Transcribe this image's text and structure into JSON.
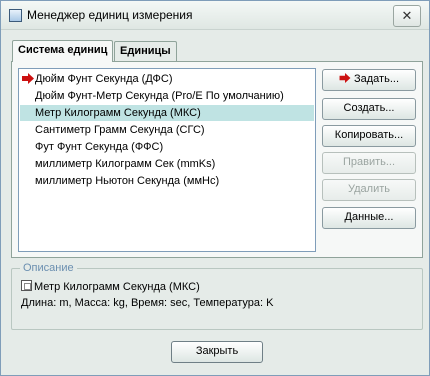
{
  "window": {
    "title": "Менеджер единиц измерения",
    "close_glyph": "✕"
  },
  "tabs": [
    {
      "label": "Система единиц",
      "active": true
    },
    {
      "label": "Единицы",
      "active": false
    }
  ],
  "list": {
    "items": [
      {
        "label": "Дюйм Фунт Секунда (ДФС)",
        "current": true,
        "selected": false
      },
      {
        "label": "Дюйм Фунт-Метр Секунда (Pro/E По умолчанию)",
        "current": false,
        "selected": false
      },
      {
        "label": "Метр Килограмм Секунда (МКС)",
        "current": false,
        "selected": true
      },
      {
        "label": "Сантиметр Грамм Секунда (СГС)",
        "current": false,
        "selected": false
      },
      {
        "label": "Фут Фунт Секунда (ФФС)",
        "current": false,
        "selected": false
      },
      {
        "label": "миллиметр Килограмм Сек (mmKs)",
        "current": false,
        "selected": false
      },
      {
        "label": "миллиметр Ньютон Секунда (ммНс)",
        "current": false,
        "selected": false
      }
    ]
  },
  "buttons": {
    "set": "Задать...",
    "create": "Создать...",
    "copy": "Копировать...",
    "edit": "Править...",
    "delete": "Удалить",
    "data": "Данные..."
  },
  "description": {
    "legend": "Описание",
    "name": "Метр Килограмм Секунда (МКС)",
    "details": "Длина: m, Масса: kg, Время: sec, Температура: K"
  },
  "footer": {
    "close_label": "Закрыть"
  },
  "colors": {
    "accent_arrow": "#cc1111",
    "selection": "#bfe3e3",
    "legend_text": "#6b8fb0"
  }
}
